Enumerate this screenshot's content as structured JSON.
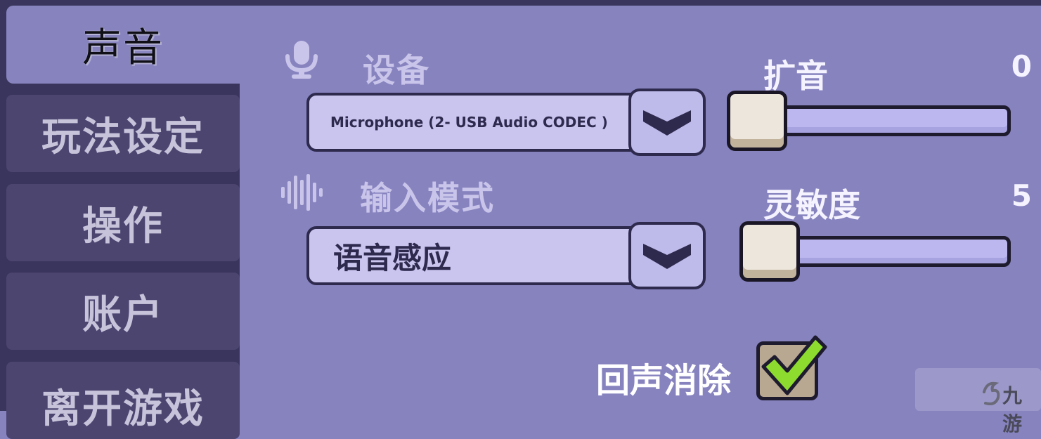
{
  "sidebar": {
    "tabs": [
      {
        "label": "声音",
        "active": true
      },
      {
        "label": "玩法设定",
        "active": false
      },
      {
        "label": "操作",
        "active": false
      },
      {
        "label": "账户",
        "active": false
      },
      {
        "label": "离开游戏",
        "active": false
      }
    ]
  },
  "device": {
    "label": "设备",
    "icon": "microphone-icon",
    "selected": "Microphone (2- USB Audio CODEC )"
  },
  "input_mode": {
    "label": "输入模式",
    "icon": "sound-wave-icon",
    "selected": "语音感应"
  },
  "amplify": {
    "label": "扩音",
    "value": "0",
    "level": 0
  },
  "sensitivity": {
    "label": "灵敏度",
    "value": "5",
    "level": 0.05
  },
  "echo_cancel": {
    "label": "回声消除",
    "checked": true
  },
  "watermark": {
    "text": "九游"
  },
  "colors": {
    "background": "#8783bf",
    "sidebar": "#3a355c",
    "tab": "#4b4570",
    "accent_check": "#8edb2f",
    "outline": "#2e2a4e"
  }
}
